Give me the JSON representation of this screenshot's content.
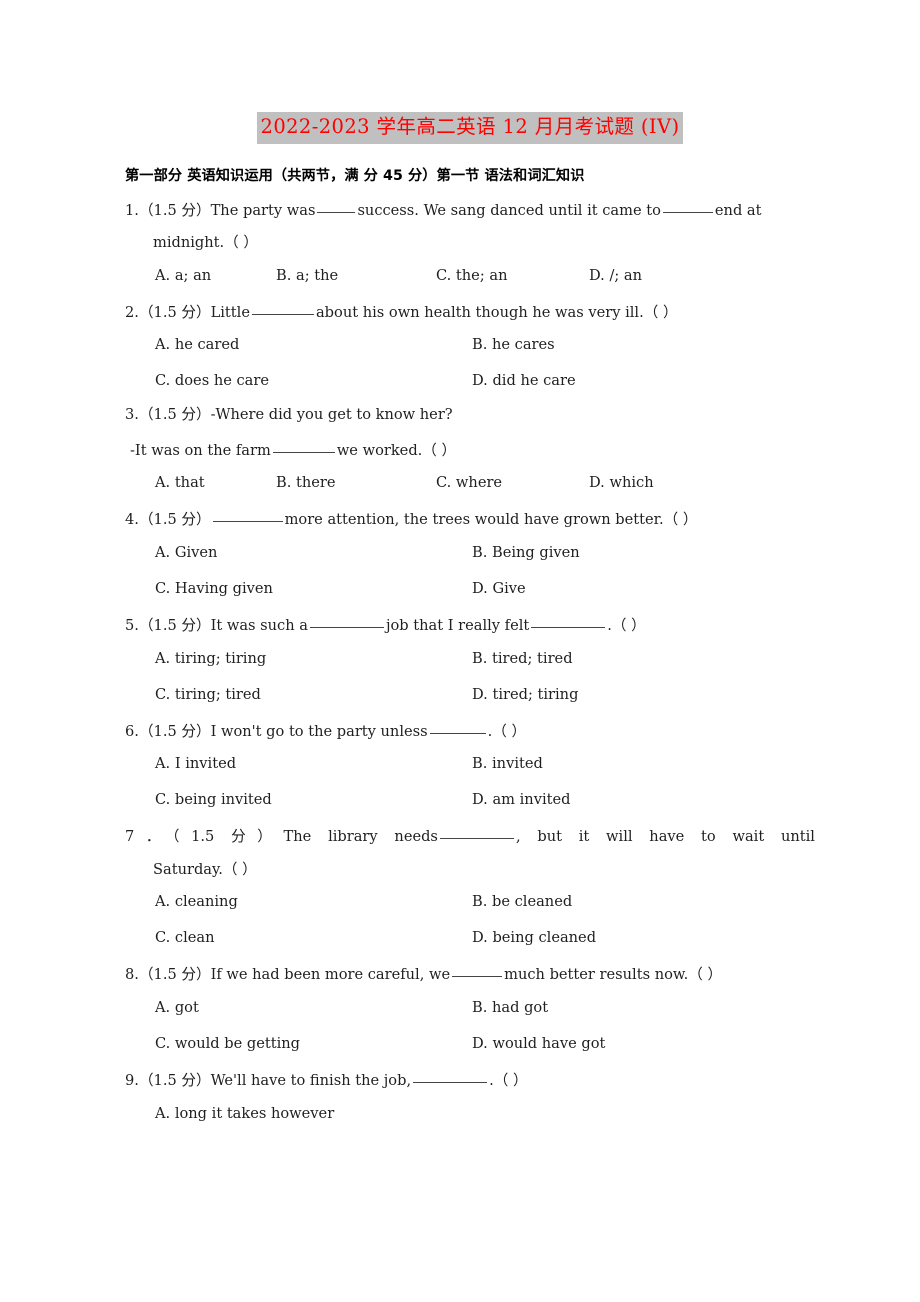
{
  "document": {
    "title": "2022-2023 学年高二英语 12 月月考试题 (IV)",
    "title_highlight_color": "#c0c0c0",
    "title_text_color": "#ff0000",
    "section_header": "第一部分 英语知识运用（共两节，满 分 45 分）第一节 语法和词汇知识"
  },
  "questions": [
    {
      "number": "1.",
      "points": "（1.5 分）",
      "stem_part1": "The party was",
      "stem_part2": "success. We sang danced until it came to",
      "stem_part3": "end at",
      "stem_line2": "midnight.（      ）",
      "layout": "cols4",
      "options": [
        "A. a;  an",
        "B. a;  the",
        "C. the;  an",
        "D. /;  an"
      ]
    },
    {
      "number": "2.",
      "points": "（1.5 分）",
      "stem_part1": "Little",
      "stem_part2": "about his own health though he was very ill.（      ）",
      "layout": "cols2",
      "options": [
        "A. he cared",
        "B. he cares",
        "C. does he care",
        "D. did he care"
      ]
    },
    {
      "number": "3.",
      "points": "（1.5 分）",
      "stem_part1": "-Where did you get to know her?",
      "stem_line2_part1": "-It was on the farm",
      "stem_line2_part2": "we worked.（      ）",
      "layout": "cols4",
      "options": [
        "A. that",
        "B. there",
        "C. where",
        "D. which"
      ]
    },
    {
      "number": "4.",
      "points": "（1.5 分）",
      "stem_part1": "",
      "stem_part2": "more attention, the trees would have grown better.（      ）",
      "layout": "cols2",
      "options": [
        "A. Given",
        "B. Being given",
        "C. Having given",
        "D. Give"
      ]
    },
    {
      "number": "5.",
      "points": "（1.5 分）",
      "stem_part1": "It was such a",
      "stem_part2": "job that I really felt",
      "stem_part3": ".（      ）",
      "layout": "cols2",
      "options": [
        "A. tiring;  tiring",
        "B. tired;  tired",
        "C. tiring;  tired",
        "D. tired;  tiring"
      ]
    },
    {
      "number": "6.",
      "points": "（1.5 分）",
      "stem_part1": "I won't go to the party unless",
      "stem_part2": ".（      ）",
      "layout": "cols2",
      "options": [
        "A. I invited",
        "B. invited",
        "C. being invited",
        "D. am invited"
      ]
    },
    {
      "number": "7．",
      "points": "（1.5 分）",
      "stem_part1": "The library needs",
      "stem_part2": ", but it will have to wait until",
      "stem_line2": "Saturday.（      ）",
      "layout": "cols2",
      "options": [
        "A. cleaning",
        "B. be cleaned",
        "C. clean",
        "D. being cleaned"
      ]
    },
    {
      "number": "8.",
      "points": "（1.5 分）",
      "stem_part1": "If we had been more careful, we",
      "stem_part2": "much better results now.（      ）",
      "layout": "cols2",
      "options": [
        "A. got",
        "B. had got",
        "C. would be getting",
        "D. would have got"
      ]
    },
    {
      "number": "9.",
      "points": "（1.5 分）",
      "stem_part1": "We'll have to finish the job,",
      "stem_part2": ".（      ）",
      "layout": "cols2",
      "options": [
        "A. long it takes however"
      ]
    }
  ]
}
